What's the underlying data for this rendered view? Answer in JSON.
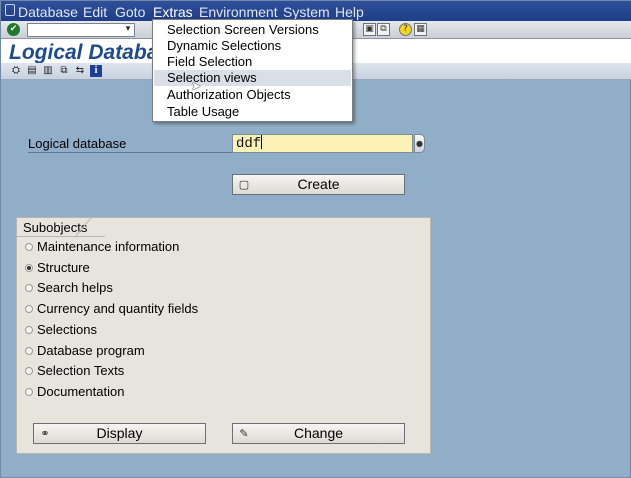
{
  "menubar": {
    "items": [
      "Database",
      "Edit",
      "Goto",
      "Extras",
      "Environment",
      "System",
      "Help"
    ],
    "active": "Extras"
  },
  "toolbar": {
    "ok_icon": "check-icon",
    "command_field_value": ""
  },
  "title": "Logical Databa",
  "extras_menu": {
    "items": [
      "Selection Screen Versions",
      "Dynamic Selections",
      "Field Selection",
      "Selection views",
      "Authorization Objects",
      "Table Usage"
    ],
    "highlighted": "Selection views"
  },
  "form": {
    "logical_db_label": "Logical database",
    "logical_db_value": "ddf",
    "create_label": "Create"
  },
  "subobjects": {
    "title": "Subobjects",
    "options": [
      {
        "label": "Maintenance information",
        "checked": false
      },
      {
        "label": "Structure",
        "checked": true
      },
      {
        "label": "Search helps",
        "checked": false
      },
      {
        "label": "Currency and quantity fields",
        "checked": false
      },
      {
        "label": "Selections",
        "checked": false
      },
      {
        "label": "Database program",
        "checked": false
      },
      {
        "label": "Selection Texts",
        "checked": false
      },
      {
        "label": "Documentation",
        "checked": false
      }
    ],
    "display_label": "Display",
    "change_label": "Change"
  },
  "colors": {
    "background": "#91aec9",
    "menubar": "#1f3e88",
    "title": "#1e4b8e",
    "input_required": "#fbf3b6",
    "group": "#e6e4dc"
  }
}
